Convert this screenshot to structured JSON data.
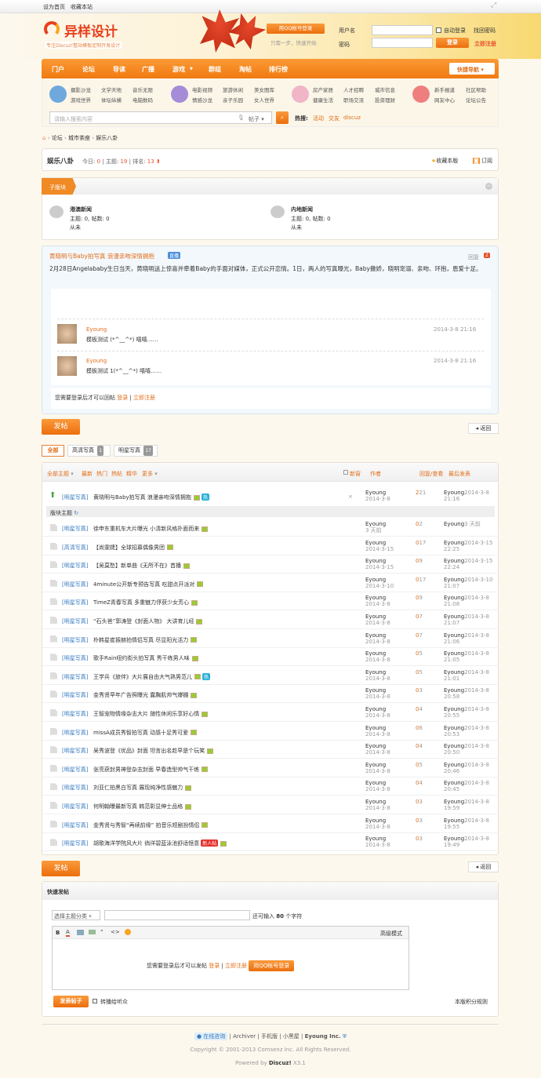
{
  "topbar": {
    "set_home": "设为首页",
    "bookmark": "收藏本站"
  },
  "header": {
    "logo_text": "异样设计",
    "logo_slogan": "专注Discuz!整站模板定制开发设计",
    "qq_login": "用QQ帐号登录",
    "qq_hint": "只需一步，快速开始",
    "username_label": "用户名",
    "password_label": "密码",
    "auto_login": "自动登录",
    "find_password": "找回密码",
    "login_btn": "登录",
    "register": "立即注册"
  },
  "nav": {
    "items": [
      "门户",
      "论坛",
      "导读",
      "广播",
      "游戏",
      "群组",
      "淘帖",
      "排行榜"
    ],
    "quick_nav": "快捷导航"
  },
  "subnav": {
    "groups": [
      [
        "摄影沙龙",
        "文学天地",
        "音乐无限",
        "游戏世界",
        "体坛纵横",
        "电脑数码"
      ],
      [
        "电影视频",
        "旅游休闲",
        "美女图库",
        "情感沙龙",
        "亲子乐园",
        "女人世界"
      ],
      [
        "房产家居",
        "人才招聘",
        "城市信息",
        "健康生活",
        "职场交流",
        "投资理财"
      ],
      [
        "新手报道",
        "社区帮助",
        "网友中心",
        "论坛公告"
      ]
    ]
  },
  "search": {
    "placeholder": "请输入搜索内容",
    "type": "帖子",
    "hot_label": "热搜:",
    "hot": [
      "活动",
      "交友",
      "discuz"
    ]
  },
  "breadcrumb": [
    "论坛",
    "城市茶座",
    "娱乐八卦"
  ],
  "forum": {
    "name": "娱乐八卦",
    "today_label": "今日:",
    "today": "0",
    "topics_label": "主题:",
    "topics": "19",
    "rank_label": "排名:",
    "rank": "13",
    "favorite": "收藏本版",
    "subscribe": "订阅"
  },
  "subforums": {
    "title": "子版块",
    "items": [
      {
        "name": "港澳新闻",
        "stats": "主题: 0, 帖数: 0",
        "last": "从未"
      },
      {
        "name": "内地新闻",
        "stats": "主题: 0, 帖数: 0",
        "last": "从未"
      }
    ]
  },
  "featured": {
    "title": "黄晓明与Baby拍写真 浪漫亲吻深情拥抱",
    "badge": "直播",
    "reply_label": "回复",
    "reply_count": "2",
    "body": "2月28日Angelababy生日当天，黄晓明送上惊喜并牵着Baby的手面对媒体，正式公开恋情。1日，两人的写真曝光，Baby撒娇，晓明宠溺、亲吻、环抱，恩爱十足。",
    "replies": [
      {
        "user": "Eyoung",
        "text": "模板测试 (*^__^*) 嘻嘻……",
        "time": "2014-3-8 21:16"
      },
      {
        "user": "Eyoung",
        "text": "模板测试 1(*^__^*) 嘻嘻……",
        "time": "2014-3-8 21:16"
      }
    ],
    "login_hint": "您需要登录后才可以回帖",
    "login": "登录",
    "register": "立即注册"
  },
  "post_btn": "发帖",
  "back_btn": "返回",
  "type_tabs": [
    {
      "label": "全部"
    },
    {
      "label": "高清写真",
      "count": "1"
    },
    {
      "label": "明星写真",
      "count": "17"
    }
  ],
  "list_header": {
    "all": "全部主题",
    "filters": [
      "最新",
      "热门",
      "热帖",
      "精华"
    ],
    "more": "更多",
    "new_window": "新窗",
    "author": "作者",
    "replies_views": "回复/查看",
    "last_post": "最后发表"
  },
  "sticky": {
    "cat": "[明星写真]",
    "title": "黄晓明与Baby拍写真 浪漫亲吻深情拥抱",
    "author": "Eyoung",
    "date": "2014-3-8",
    "replies": "2",
    "views": "21",
    "last_user": "Eyoung",
    "last_time": "2014-3-8 21:16",
    "section": "版块主题"
  },
  "threads": [
    {
      "cat": "[明星写真]",
      "title": "徐申东重机车大片曝光 小清新风格扑面而来",
      "date": "3 天前",
      "replies": "0",
      "views": "2",
      "last": "3 天前"
    },
    {
      "cat": "[高清写真]",
      "title": "【尚雯婕】全球招募偶像男团",
      "date": "2014-3-15",
      "replies": "0",
      "views": "17",
      "last": "2014-3-15 22:25"
    },
    {
      "cat": "[明星写真]",
      "title": "【吴莫愁】新单曲《无所不在》首播",
      "date": "2014-3-15",
      "replies": "0",
      "views": "9",
      "last": "2014-3-15 22:24"
    },
    {
      "cat": "[明星写真]",
      "title": "4minute公开新专预告写真 吃甜点开派对",
      "date": "2014-3-10",
      "replies": "0",
      "views": "17",
      "last": "2014-3-10 21:07"
    },
    {
      "cat": "[明星写真]",
      "title": "TimeZ青春写真 多重魅力俘获少女芳心",
      "date": "2014-3-8",
      "replies": "0",
      "views": "9",
      "last": "2014-3-8 21:08"
    },
    {
      "cat": "[明星写真]",
      "title": "“石头爸”郭涛登《封面人物》 大讲育儿经",
      "date": "2014-3-8",
      "replies": "0",
      "views": "7",
      "last": "2014-3-8 21:07"
    },
    {
      "cat": "[明星写真]",
      "title": "朴韩星崔振赫拍情侣写真 尽显阳光活力",
      "date": "2014-3-8",
      "replies": "0",
      "views": "7",
      "last": "2014-3-8 21:06"
    },
    {
      "cat": "[明星写真]",
      "title": "歌手Rain纽约街头拍写真 秀干练男人味",
      "date": "2014-3-8",
      "replies": "0",
      "views": "5",
      "last": "2014-3-8 21:05"
    },
    {
      "cat": "[明星写真]",
      "title": "王学兵《旅伴》大片展自由大气熟男范儿",
      "date": "2014-3-8",
      "replies": "0",
      "views": "5",
      "last": "2014-3-8 21:01",
      "hot": true
    },
    {
      "cat": "[明星写真]",
      "title": "金秀贤早年广告照曝光 露胸肌帅气爆棚",
      "date": "2014-3-8",
      "replies": "0",
      "views": "3",
      "last": "2014-3-8 20:58"
    },
    {
      "cat": "[明星写真]",
      "title": "王智宠物情缘杂志大片 随性休闲乐享好心情",
      "date": "2014-3-8",
      "replies": "0",
      "views": "4",
      "last": "2014-3-8 20:55"
    },
    {
      "cat": "[明星写真]",
      "title": "missA成员秀智拍写真 动感十足秀可爱",
      "date": "2014-3-8",
      "replies": "0",
      "views": "6",
      "last": "2014-3-8 20:53"
    },
    {
      "cat": "[明星写真]",
      "title": "吴秀波登《优品》封面 坦言出名趁早是个玩笑",
      "date": "2014-3-8",
      "replies": "0",
      "views": "4",
      "last": "2014-3-8 20:50"
    },
    {
      "cat": "[明星写真]",
      "title": "张亮获封男神登杂志封面 早春造型帅气干练",
      "date": "2014-3-8",
      "replies": "0",
      "views": "5",
      "last": "2014-3-8 20:46"
    },
    {
      "cat": "[明星写真]",
      "title": "刘亚仁拍黑白写真 展现纯净性感魅力",
      "date": "2014-3-8",
      "replies": "0",
      "views": "4",
      "last": "2014-3-8 20:45"
    },
    {
      "cat": "[明星写真]",
      "title": "何明翰曝最新写真 韩范彰显绅士品格",
      "date": "2014-3-8",
      "replies": "0",
      "views": "3",
      "last": "2014-3-8 19:59"
    },
    {
      "cat": "[明星写真]",
      "title": "金秀贤与秀智“再续前缘” 拍音乐短剧扮情侣",
      "date": "2014-3-8",
      "replies": "0",
      "views": "3",
      "last": "2014-3-8 19:55"
    },
    {
      "cat": "[明星写真]",
      "title": "胡歌海洋学院风大片 徜徉碧蓝泳池舒适惬意",
      "date": "2014-3-8",
      "replies": "0",
      "views": "3",
      "last": "2014-3-8 19:49",
      "newbie": "新人帖"
    }
  ],
  "thread_author": "Eyoung",
  "quickpost": {
    "title": "快速发帖",
    "category": "选择主题分类",
    "char_hint_pre": "还可输入",
    "char_count": "80",
    "char_hint_post": "个字符",
    "advanced": "高级模式",
    "login_hint": "您需要登录后才可以发帖",
    "login": "登录",
    "register": "立即注册",
    "qq_login": "用QQ帐号登录",
    "submit": "发表帖子",
    "forward": "转播给听众",
    "rules": "本版积分规则"
  },
  "footer": {
    "online": "在线咨询",
    "links": [
      "Archiver",
      "手机版",
      "小黑屋"
    ],
    "company": "Eyoung Inc.",
    "copyright": "Copyright © 2001-2013 Comsenz Inc.   All Rights Reserved.",
    "powered_pre": "Powered by",
    "powered_brand": "Discuz!",
    "powered_ver": "X3.1"
  },
  "colors": {
    "accent": "#f07a10",
    "link": "#3a7bc0",
    "red": "#e6502d"
  }
}
